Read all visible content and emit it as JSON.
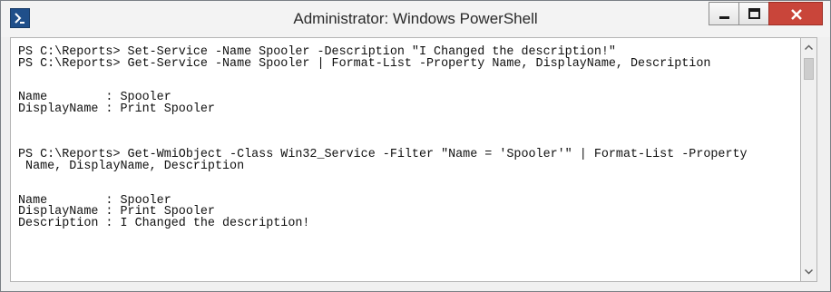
{
  "window": {
    "title": "Administrator: Windows PowerShell",
    "icon": "powershell-icon",
    "controls": [
      "minimize-icon",
      "maximize-icon",
      "close-icon"
    ]
  },
  "console": {
    "lines": [
      "PS C:\\Reports> Set-Service -Name Spooler -Description \"I Changed the description!\"",
      "PS C:\\Reports> Get-Service -Name Spooler | Format-List -Property Name, DisplayName, Description",
      "",
      "",
      "Name        : Spooler",
      "DisplayName : Print Spooler",
      "",
      "",
      "",
      "PS C:\\Reports> Get-WmiObject -Class Win32_Service -Filter \"Name = 'Spooler'\" | Format-List -Property",
      " Name, DisplayName, Description",
      "",
      "",
      "Name        : Spooler",
      "DisplayName : Print Spooler",
      "Description : I Changed the description!"
    ]
  },
  "scrollbar": {
    "up_icon": "chevron-up-icon",
    "down_icon": "chevron-down-icon"
  }
}
